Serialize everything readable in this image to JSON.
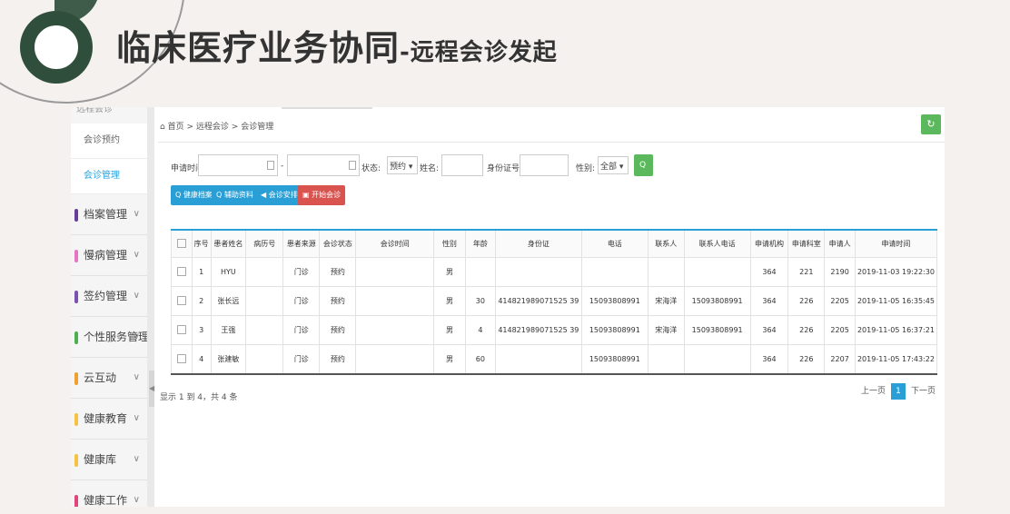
{
  "slide": {
    "title": "临床医疗业务协同",
    "subtitle": "-远程会诊发起"
  },
  "colors": {
    "accent": "#2a9fd6",
    "green": "#5cb85c",
    "logo": "#2f4f3c"
  },
  "sidebar": {
    "top_label": "远程会诊",
    "subitems": [
      "会诊预约",
      "会诊管理"
    ],
    "items": [
      {
        "label": "档案管理",
        "color": "#6a3d9a"
      },
      {
        "label": "慢病管理",
        "color": "#e377c2"
      },
      {
        "label": "签约管理",
        "color": "#7b52ae"
      },
      {
        "label": "个性服务管理",
        "color": "#4caf50"
      },
      {
        "label": "云互动",
        "color": "#f0a030"
      },
      {
        "label": "健康教育",
        "color": "#f5c242"
      },
      {
        "label": "健康库",
        "color": "#f5c242"
      },
      {
        "label": "健康工作",
        "color": "#e0457b"
      }
    ]
  },
  "breadcrumb": {
    "home": "首页",
    "sep": ">",
    "level1": "远程会诊",
    "level2": "会诊管理"
  },
  "filter": {
    "apply_time_label": "申请时间:",
    "dash": "-",
    "status_label": "状态:",
    "status_value": "预约",
    "name_label": "姓名:",
    "id_label": "身份证号:",
    "gender_label": "性别:",
    "gender_value": "全部",
    "search_label": "Q 查询"
  },
  "actions": [
    {
      "label": "Q 健康档案",
      "color": "#2a9fd6"
    },
    {
      "label": "Q 辅助资料",
      "color": "#2a9fd6"
    },
    {
      "label": "◀ 会诊安排",
      "color": "#2a9fd6"
    },
    {
      "label": "▣ 开始会诊",
      "color": "#d9534f"
    }
  ],
  "table": {
    "headers": [
      "序号",
      "患者姓名",
      "病历号",
      "患者来源",
      "会诊状态",
      "会诊时间",
      "性别",
      "年龄",
      "身份证",
      "电话",
      "联系人",
      "联系人电话",
      "申请机构",
      "申请科室",
      "申请人",
      "申请时间"
    ],
    "rows": [
      [
        "1",
        "HYU",
        "",
        "门诊",
        "预约",
        "",
        "男",
        "",
        "",
        "",
        "",
        "",
        "364",
        "221",
        "2190",
        "2019-11-03 19:22:30"
      ],
      [
        "2",
        "张长远",
        "",
        "门诊",
        "预约",
        "",
        "男",
        "30",
        "414821989071525 39",
        "15093808991",
        "宋海洋",
        "15093808991",
        "364",
        "226",
        "2205",
        "2019-11-05 16:35:45"
      ],
      [
        "3",
        "王强",
        "",
        "门诊",
        "预约",
        "",
        "男",
        "4",
        "414821989071525 39",
        "15093808991",
        "宋海洋",
        "15093808991",
        "364",
        "226",
        "2205",
        "2019-11-05 16:37:21"
      ],
      [
        "4",
        "张建敏",
        "",
        "门诊",
        "预约",
        "",
        "男",
        "60",
        "",
        "15093808991",
        "",
        "",
        "364",
        "226",
        "2207",
        "2019-11-05 17:43:22"
      ]
    ]
  },
  "pagination": {
    "info": "显示 1 到 4，共 4 条",
    "prev": "上一页",
    "current": "1",
    "next": "下一页"
  }
}
